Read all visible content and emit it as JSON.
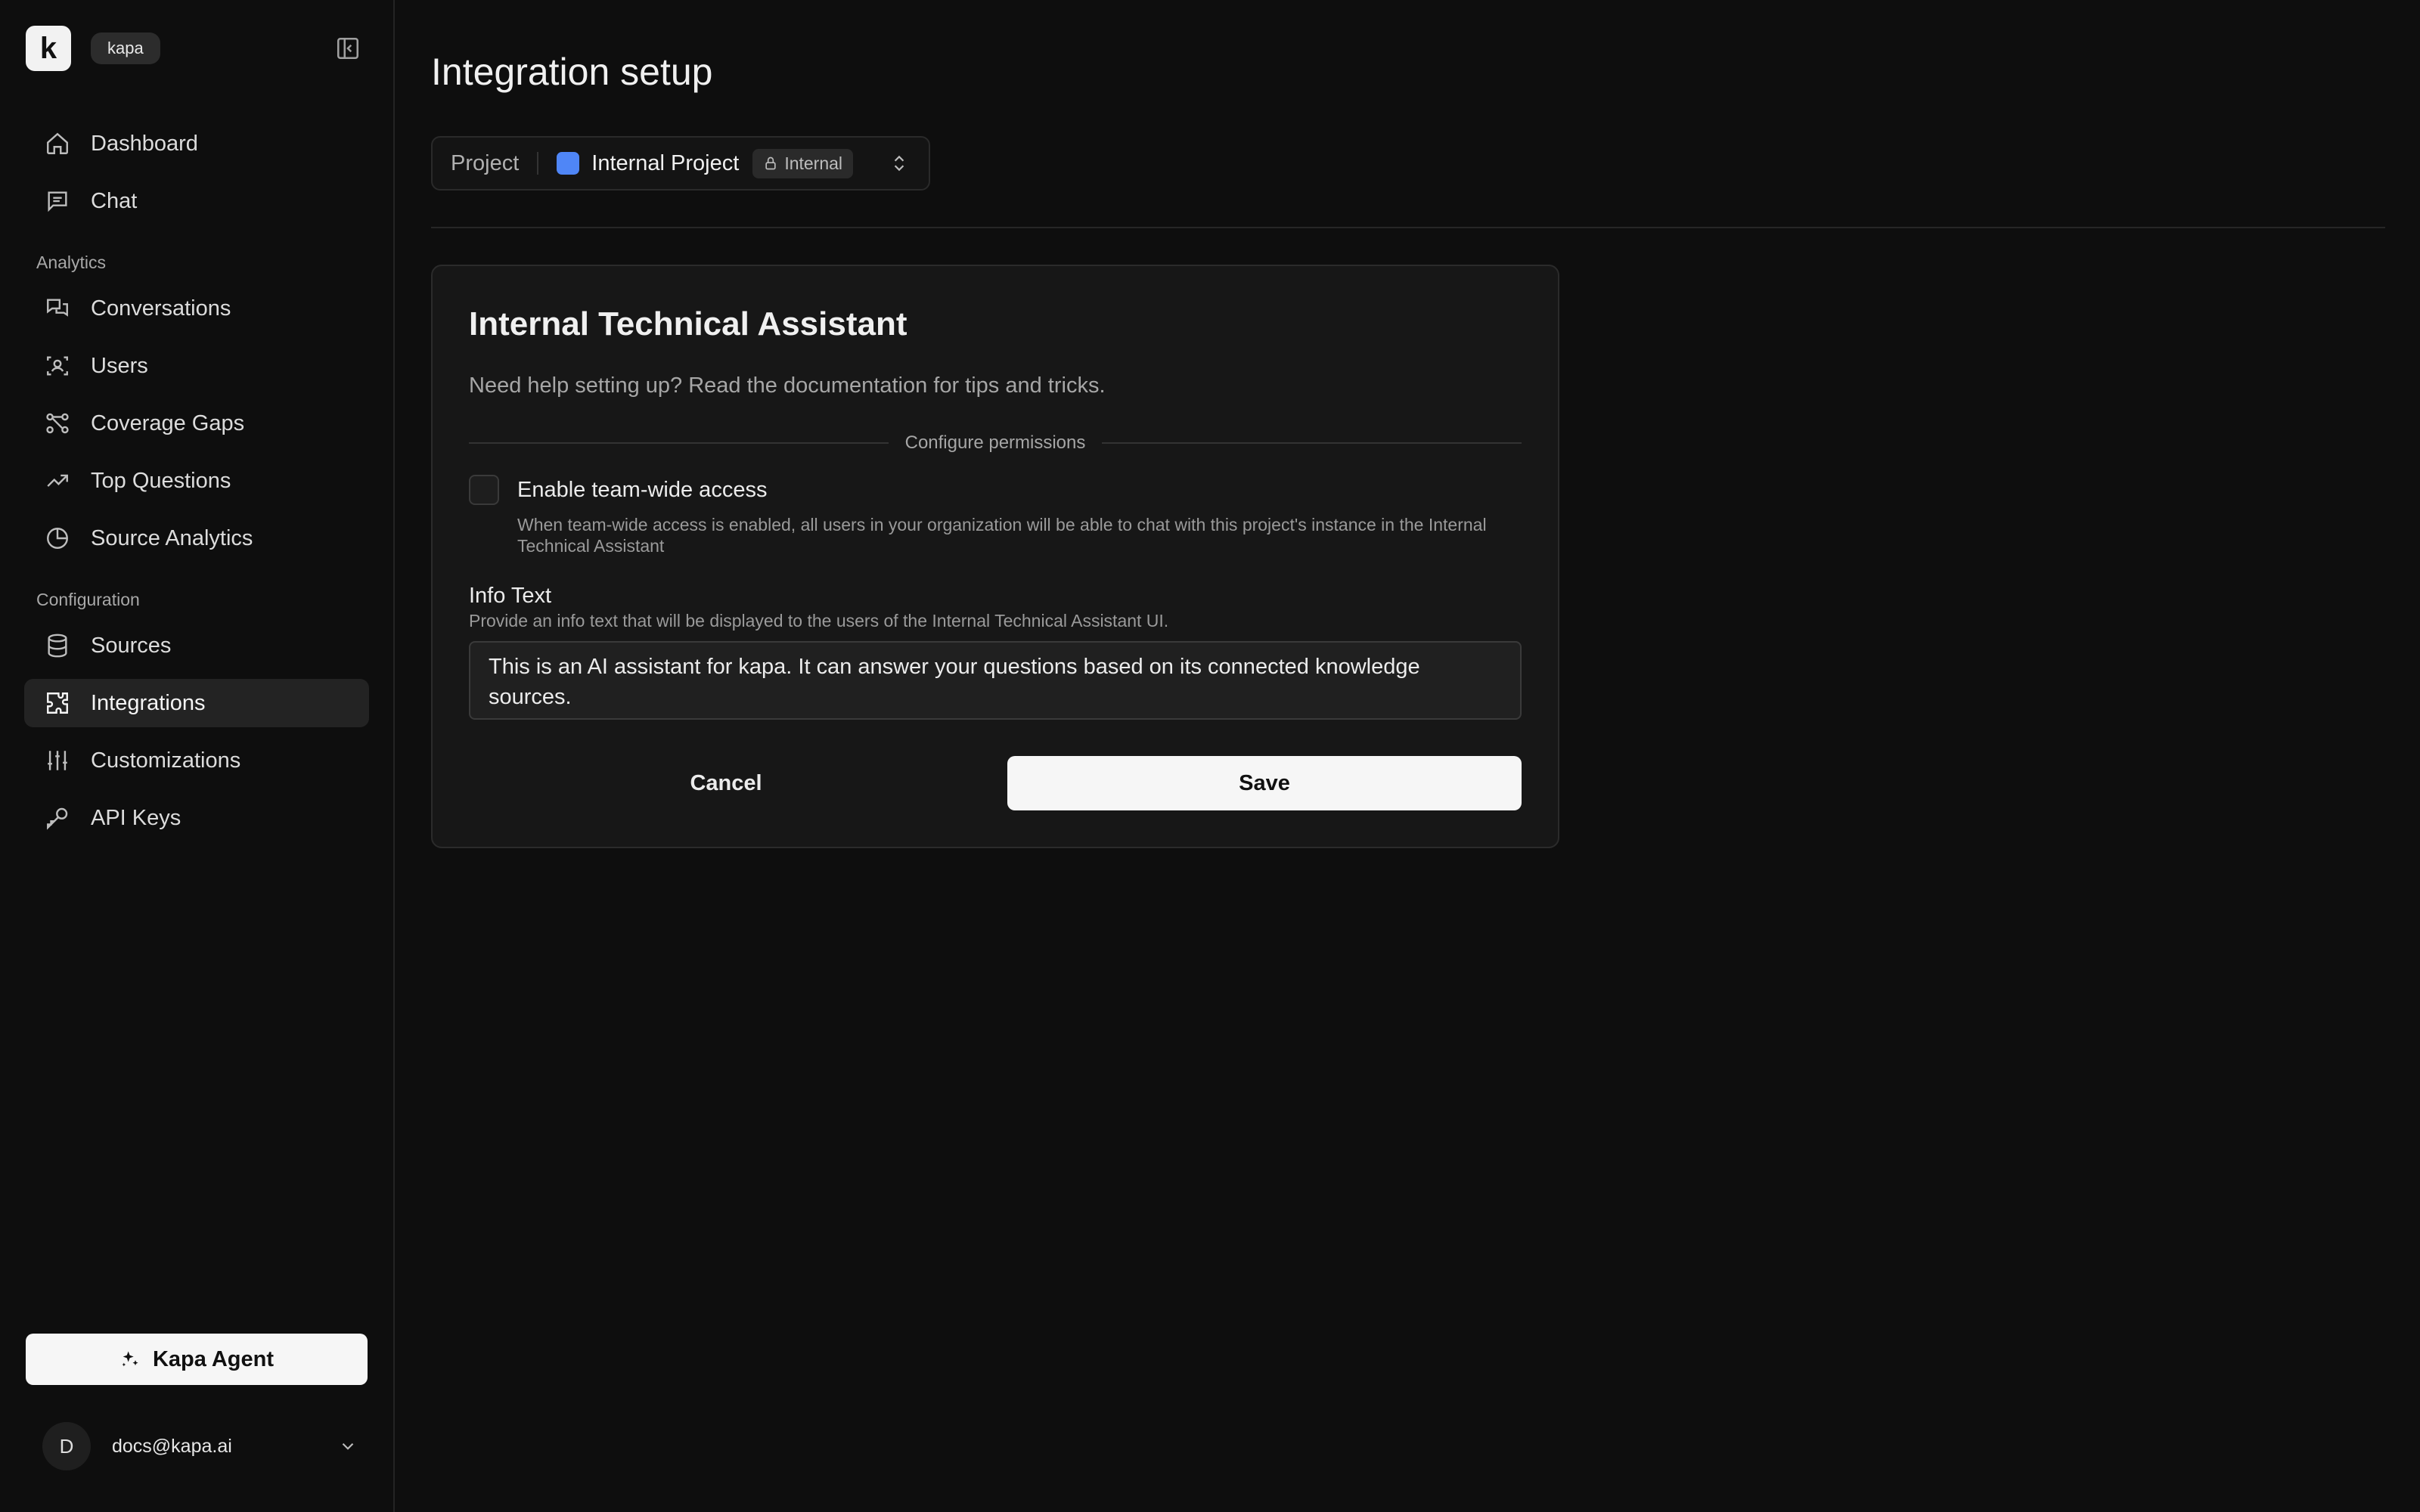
{
  "sidebar": {
    "logo_letter": "k",
    "org_name": "kapa",
    "nav_main": [
      {
        "label": "Dashboard",
        "icon": "home-icon"
      },
      {
        "label": "Chat",
        "icon": "chat-icon"
      }
    ],
    "analytics_label": "Analytics",
    "nav_analytics": [
      {
        "label": "Conversations",
        "icon": "conversations-icon"
      },
      {
        "label": "Users",
        "icon": "users-icon"
      },
      {
        "label": "Coverage Gaps",
        "icon": "coverage-gaps-icon"
      },
      {
        "label": "Top Questions",
        "icon": "trending-icon"
      },
      {
        "label": "Source Analytics",
        "icon": "pie-chart-icon"
      }
    ],
    "configuration_label": "Configuration",
    "nav_configuration": [
      {
        "label": "Sources",
        "icon": "database-icon"
      },
      {
        "label": "Integrations",
        "icon": "puzzle-icon",
        "active": true
      },
      {
        "label": "Customizations",
        "icon": "sliders-icon"
      },
      {
        "label": "API Keys",
        "icon": "key-icon"
      }
    ],
    "agent_button": "Kapa Agent",
    "user": {
      "initial": "D",
      "email": "docs@kapa.ai"
    }
  },
  "main": {
    "title": "Integration setup",
    "project_switcher": {
      "label": "Project",
      "name": "Internal Project",
      "badge": "Internal",
      "swatch_color": "#4f86f7"
    },
    "card": {
      "title": "Internal Technical Assistant",
      "description": "Need help setting up? Read the documentation for tips and tricks.",
      "section_label": "Configure permissions",
      "team_access": {
        "label": "Enable team-wide access",
        "help": "When team-wide access is enabled, all users in your organization will be able to chat with this project's instance in the Internal Technical Assistant",
        "checked": false
      },
      "info_text": {
        "label": "Info Text",
        "help": "Provide an info text that will be displayed to the users of the Internal Technical Assistant UI.",
        "value": "This is an AI assistant for kapa. It can answer your questions based on its connected knowledge sources."
      },
      "cancel_label": "Cancel",
      "save_label": "Save"
    }
  }
}
